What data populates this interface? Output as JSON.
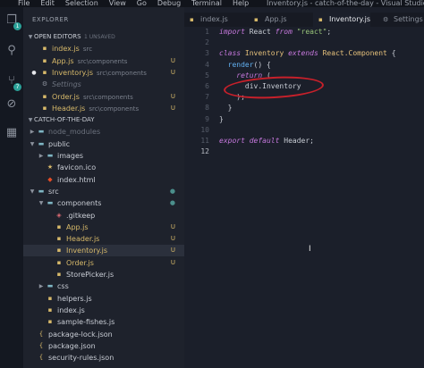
{
  "window": {
    "title": "Inventory.js - catch-of-the-day - Visual Studio Code",
    "menu": [
      "File",
      "Edit",
      "Selection",
      "View",
      "Go",
      "Debug",
      "Terminal",
      "Help"
    ]
  },
  "activity_bar": [
    {
      "icon": "files-icon",
      "glyph": "❐",
      "badge": "1"
    },
    {
      "icon": "search-icon",
      "glyph": "⚲",
      "badge": ""
    },
    {
      "icon": "source-control-icon",
      "glyph": "⑂",
      "badge": "7"
    },
    {
      "icon": "debug-icon",
      "glyph": "⊘",
      "badge": ""
    },
    {
      "icon": "extensions-icon",
      "glyph": "▦",
      "badge": ""
    }
  ],
  "sidebar": {
    "header": "EXPLORER",
    "open_editors": {
      "label": "OPEN EDITORS",
      "unsaved": "1 UNSAVED",
      "items": [
        {
          "name": "index.js",
          "desc": "src",
          "icon": "js-icon",
          "color": "#d7b96a",
          "status": ""
        },
        {
          "name": "App.js",
          "desc": "src\\components",
          "icon": "js-icon",
          "color": "#d7b96a",
          "status": "U"
        },
        {
          "name": "Inventory.js",
          "desc": "src\\components",
          "icon": "js-icon",
          "color": "#d7b96a",
          "status": "U",
          "modified": "●"
        },
        {
          "name": "Settings",
          "desc": "",
          "icon": "settings-icon",
          "color": "#6b717d",
          "status": ""
        },
        {
          "name": "Order.js",
          "desc": "src\\components",
          "icon": "js-icon",
          "color": "#d7b96a",
          "status": "U"
        },
        {
          "name": "Header.js",
          "desc": "src\\components",
          "icon": "js-icon",
          "color": "#d7b96a",
          "status": "U"
        }
      ]
    },
    "project": {
      "label": "CATCH-OF-THE-DAY",
      "tree": [
        {
          "name": "node_modules",
          "depth": 1,
          "type": "folder",
          "open": false,
          "color": "#6b717d",
          "status": ""
        },
        {
          "name": "public",
          "depth": 1,
          "type": "folder",
          "open": true,
          "color": "#c8ccd4",
          "status": ""
        },
        {
          "name": "images",
          "depth": 2,
          "type": "folder",
          "open": false,
          "color": "#c8ccd4",
          "status": ""
        },
        {
          "name": "favicon.ico",
          "depth": 2,
          "type": "file",
          "icon": "star-icon",
          "color": "#c8ccd4",
          "status": ""
        },
        {
          "name": "index.html",
          "depth": 2,
          "type": "file",
          "icon": "html-icon",
          "color": "#c8ccd4",
          "status": ""
        },
        {
          "name": "src",
          "depth": 1,
          "type": "folder",
          "open": true,
          "color": "#c8ccd4",
          "status": "●"
        },
        {
          "name": "components",
          "depth": 2,
          "type": "folder",
          "open": true,
          "color": "#c8ccd4",
          "status": "●"
        },
        {
          "name": ".gitkeep",
          "depth": 3,
          "type": "file",
          "icon": "git-icon",
          "color": "#c8ccd4",
          "status": ""
        },
        {
          "name": "App.js",
          "depth": 3,
          "type": "file",
          "icon": "js-icon",
          "color": "#d7b96a",
          "status": "U"
        },
        {
          "name": "Header.js",
          "depth": 3,
          "type": "file",
          "icon": "js-icon",
          "color": "#d7b96a",
          "status": "U"
        },
        {
          "name": "Inventory.js",
          "depth": 3,
          "type": "file",
          "icon": "js-icon",
          "color": "#d7b96a",
          "status": "U",
          "active": true
        },
        {
          "name": "Order.js",
          "depth": 3,
          "type": "file",
          "icon": "js-icon",
          "color": "#d7b96a",
          "status": "U"
        },
        {
          "name": "StorePicker.js",
          "depth": 3,
          "type": "file",
          "icon": "js-icon",
          "color": "#c8ccd4",
          "status": ""
        },
        {
          "name": "css",
          "depth": 2,
          "type": "folder",
          "open": false,
          "color": "#c8ccd4",
          "status": ""
        },
        {
          "name": "helpers.js",
          "depth": 2,
          "type": "file",
          "icon": "js-icon",
          "color": "#c8ccd4",
          "status": ""
        },
        {
          "name": "index.js",
          "depth": 2,
          "type": "file",
          "icon": "js-icon",
          "color": "#c8ccd4",
          "status": ""
        },
        {
          "name": "sample-fishes.js",
          "depth": 2,
          "type": "file",
          "icon": "js-icon",
          "color": "#c8ccd4",
          "status": ""
        },
        {
          "name": "package-lock.json",
          "depth": 1,
          "type": "file",
          "icon": "json-icon",
          "color": "#c8ccd4",
          "status": ""
        },
        {
          "name": "package.json",
          "depth": 1,
          "type": "file",
          "icon": "json-icon",
          "color": "#c8ccd4",
          "status": ""
        },
        {
          "name": "security-rules.json",
          "depth": 1,
          "type": "file",
          "icon": "json-icon",
          "color": "#c8ccd4",
          "status": ""
        }
      ]
    }
  },
  "tabs": [
    {
      "label": "index.js",
      "active": false
    },
    {
      "label": "App.js",
      "active": false
    },
    {
      "label": "Inventory.js",
      "active": true
    },
    {
      "label": "Settings",
      "active": false
    }
  ],
  "editor": {
    "current_line": 12,
    "lines": [
      [
        {
          "t": "import",
          "c": "kw"
        },
        {
          "t": " React ",
          "c": "pl"
        },
        {
          "t": "from",
          "c": "kw"
        },
        {
          "t": " \"react\"",
          "c": "str"
        },
        {
          "t": ";",
          "c": "pl"
        }
      ],
      [],
      [
        {
          "t": "class",
          "c": "kw"
        },
        {
          "t": " Inventory ",
          "c": "cls"
        },
        {
          "t": "extends",
          "c": "kw"
        },
        {
          "t": " React.Component ",
          "c": "cls"
        },
        {
          "t": "{",
          "c": "pl"
        }
      ],
      [
        {
          "t": "  render",
          "c": "fn"
        },
        {
          "t": "() {",
          "c": "pl"
        }
      ],
      [
        {
          "t": "    return",
          "c": "kw"
        },
        {
          "t": " (",
          "c": "pl"
        }
      ],
      [
        {
          "t": "      div.Inventory",
          "c": "pl"
        }
      ],
      [
        {
          "t": "    );",
          "c": "pl"
        }
      ],
      [
        {
          "t": "  }",
          "c": "pl"
        }
      ],
      [
        {
          "t": "}",
          "c": "pl"
        }
      ],
      [],
      [
        {
          "t": "export",
          "c": "kw"
        },
        {
          "t": " default",
          "c": "kw"
        },
        {
          "t": " Header;",
          "c": "pl"
        }
      ],
      []
    ]
  }
}
